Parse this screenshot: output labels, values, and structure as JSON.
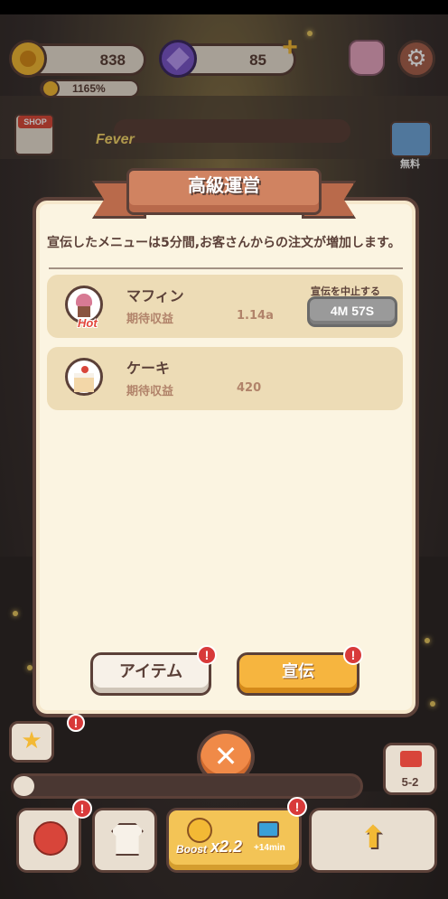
{
  "hud": {
    "coins": "838",
    "gems": "85",
    "rate": "1165%",
    "fever_label": "Fever",
    "shop_label": "SHOP",
    "free_label": "無料"
  },
  "modal": {
    "title": "高級運営",
    "description": "宣伝したメニューは5分間,お客さんからの注文が増加します。",
    "menu_items": [
      {
        "name": "マフィン",
        "sub_label": "期待収益",
        "value": "1.14a",
        "badge": "Hot",
        "stop_label": "宣伝を中止する",
        "timer": "4M 57S",
        "icon": "muffin-icon"
      },
      {
        "name": "ケーキ",
        "sub_label": "期待収益",
        "value": "420",
        "icon": "cake-icon"
      }
    ],
    "item_button": "アイテム",
    "ad_button": "宣伝"
  },
  "bottom": {
    "stage": "5-2",
    "boost_label": "Boost",
    "boost_multiplier": "x2.2",
    "boost_time": "+14min",
    "progress": 0.06
  },
  "colors": {
    "outline": "#5b4038",
    "ribbon": "#d08361",
    "panel": "#fbf4e1",
    "ad_button": "#f6b53f",
    "alert": "#d83a3a",
    "close": "#f08a48"
  }
}
